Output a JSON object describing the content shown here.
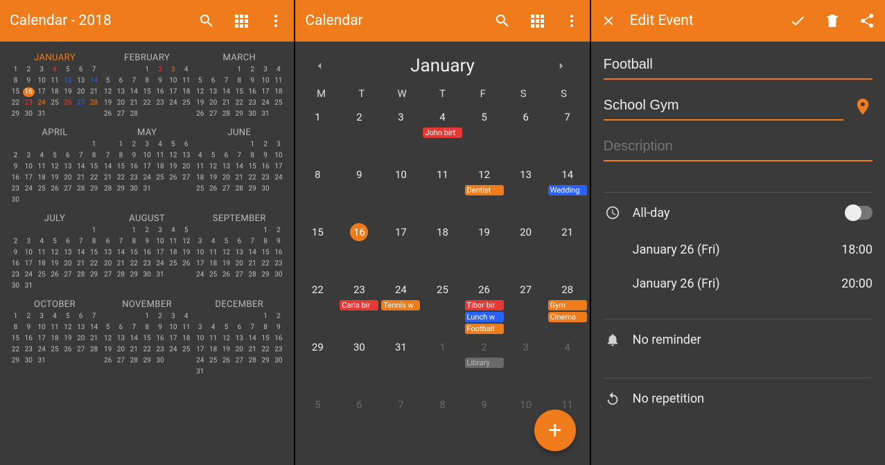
{
  "screens": {
    "year": {
      "title": "Calendar - 2018",
      "months": [
        {
          "name": "JANUARY",
          "current": true,
          "startDow": 0,
          "days": 31,
          "events": {
            "4": "red",
            "12": "blue",
            "14": "blue",
            "16": "today",
            "23": "red",
            "24": "orange",
            "26": "red",
            "27": "blue",
            "28": "orange"
          }
        },
        {
          "name": "FEBRUARY",
          "startDow": 3,
          "days": 28,
          "events": {
            "2": "red",
            "3": "orange"
          }
        },
        {
          "name": "MARCH",
          "startDow": 3,
          "days": 31,
          "events": {}
        },
        {
          "name": "APRIL",
          "startDow": 6,
          "days": 30,
          "events": {}
        },
        {
          "name": "MAY",
          "startDow": 1,
          "days": 31,
          "events": {}
        },
        {
          "name": "JUNE",
          "startDow": 4,
          "days": 30,
          "events": {}
        },
        {
          "name": "JULY",
          "startDow": 6,
          "days": 31,
          "events": {}
        },
        {
          "name": "AUGUST",
          "startDow": 2,
          "days": 31,
          "events": {}
        },
        {
          "name": "SEPTEMBER",
          "startDow": 5,
          "days": 30,
          "events": {}
        },
        {
          "name": "OCTOBER",
          "startDow": 0,
          "days": 31,
          "events": {}
        },
        {
          "name": "NOVEMBER",
          "startDow": 3,
          "days": 30,
          "events": {}
        },
        {
          "name": "DECEMBER",
          "startDow": 5,
          "days": 31,
          "events": {}
        }
      ]
    },
    "month": {
      "title": "Calendar",
      "label": "January",
      "dow": [
        "M",
        "T",
        "W",
        "T",
        "F",
        "S",
        "S"
      ],
      "today": 16,
      "weeks": [
        [
          {
            "n": 1
          },
          {
            "n": 2
          },
          {
            "n": 3
          },
          {
            "n": 4,
            "chips": [
              {
                "t": "John birt",
                "c": "red"
              }
            ]
          },
          {
            "n": 5
          },
          {
            "n": 6
          },
          {
            "n": 7
          }
        ],
        [
          {
            "n": 8
          },
          {
            "n": 9
          },
          {
            "n": 10
          },
          {
            "n": 11
          },
          {
            "n": 12,
            "chips": [
              {
                "t": "Dentist",
                "c": "orange"
              }
            ]
          },
          {
            "n": 13
          },
          {
            "n": 14,
            "chips": [
              {
                "t": "Wedding",
                "c": "blue"
              }
            ]
          }
        ],
        [
          {
            "n": 15
          },
          {
            "n": 16
          },
          {
            "n": 17
          },
          {
            "n": 18
          },
          {
            "n": 19
          },
          {
            "n": 20
          },
          {
            "n": 21
          }
        ],
        [
          {
            "n": 22
          },
          {
            "n": 23,
            "chips": [
              {
                "t": "Carla bir",
                "c": "red"
              }
            ]
          },
          {
            "n": 24,
            "chips": [
              {
                "t": "Tennis w",
                "c": "orange"
              }
            ]
          },
          {
            "n": 25
          },
          {
            "n": 26,
            "chips": [
              {
                "t": "Tibor bir",
                "c": "red"
              },
              {
                "t": "Lunch w",
                "c": "blue"
              },
              {
                "t": "Football",
                "c": "orange"
              }
            ]
          },
          {
            "n": 27
          },
          {
            "n": 28,
            "chips": [
              {
                "t": "Gym",
                "c": "orange"
              },
              {
                "t": "Cinema",
                "c": "orange"
              }
            ]
          }
        ],
        [
          {
            "n": 29
          },
          {
            "n": 30
          },
          {
            "n": 31
          },
          {
            "n": 1,
            "out": true
          },
          {
            "n": 2,
            "out": true,
            "chips": [
              {
                "t": "Library",
                "c": "grey"
              }
            ]
          },
          {
            "n": 3,
            "out": true
          },
          {
            "n": 4,
            "out": true
          }
        ],
        [
          {
            "n": 5,
            "out": true
          },
          {
            "n": 6,
            "out": true
          },
          {
            "n": 7,
            "out": true
          },
          {
            "n": 8,
            "out": true
          },
          {
            "n": 9,
            "out": true
          },
          {
            "n": 10,
            "out": true
          },
          {
            "n": 11,
            "out": true
          }
        ]
      ]
    },
    "edit": {
      "title": "Edit Event",
      "title_value": "Football",
      "location_value": "School Gym",
      "description_placeholder": "Description",
      "allday_label": "All-day",
      "allday_on": false,
      "start_date": "January 26 (Fri)",
      "start_time": "18:00",
      "end_date": "January 26 (Fri)",
      "end_time": "20:00",
      "reminder_label": "No reminder",
      "repetition_label": "No repetition"
    }
  }
}
